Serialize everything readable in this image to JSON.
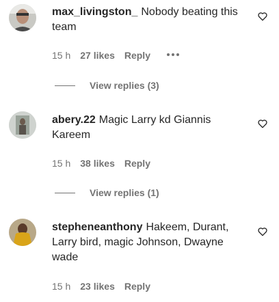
{
  "comments": [
    {
      "username": "max_livingston_",
      "text": "Nobody beating this team",
      "time": "15 h",
      "likes": "27 likes",
      "reply": "Reply",
      "more_icon": "more-dots-icon",
      "view_replies": "View replies (3)"
    },
    {
      "username": "abery.22",
      "text": "Magic Larry kd Giannis Kareem",
      "time": "15 h",
      "likes": "38 likes",
      "reply": "Reply",
      "view_replies": "View replies (1)"
    },
    {
      "username": "stepheneanthony",
      "text": "Hakeem, Durant, Larry bird, magic Johnson, Dwayne wade",
      "time": "15 h",
      "likes": "23 likes",
      "reply": "Reply"
    }
  ],
  "icons": {
    "like": "heart-outline-icon",
    "more": "more-dots-icon"
  },
  "colors": {
    "text": "#262626",
    "secondary": "#737373",
    "background": "#ffffff"
  }
}
